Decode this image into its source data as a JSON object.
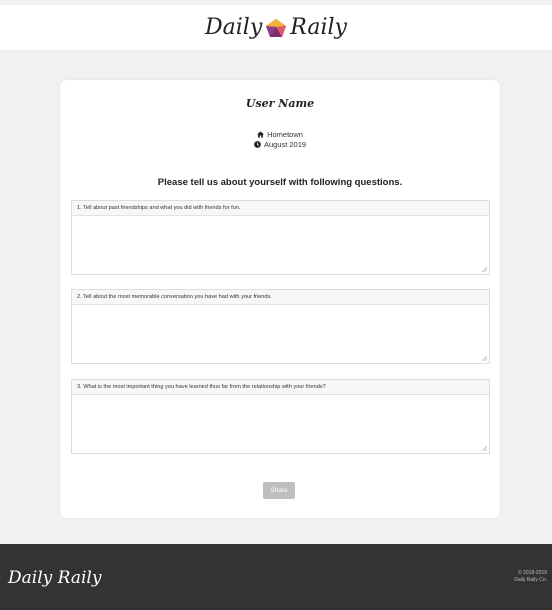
{
  "header": {
    "logo_left": "Daily",
    "logo_right": "Raily",
    "logo_icon": "pentagon-gem-icon"
  },
  "profile": {
    "name": "User Name",
    "hometown": "Hometown",
    "date": "August 2019",
    "hometown_icon": "home-icon",
    "date_icon": "clock-icon"
  },
  "form": {
    "prompt": "Please tell us about yourself with following questions.",
    "questions": [
      {
        "label": "1. Tell about past friendships and what you did with friends for fun.",
        "value": ""
      },
      {
        "label": "2. Tell about the most memorable conversation you have had with your friends.",
        "value": ""
      },
      {
        "label": "3. What is the most important thing you have learned thus far from the relationship with your friends?",
        "value": ""
      }
    ],
    "share_label": "Share"
  },
  "footer": {
    "logo": "Daily Raily",
    "copyright_line1": "© 2018-2019",
    "copyright_line2": "Daily Raily Co."
  },
  "colors": {
    "page_bg": "#f1f1f1",
    "footer_bg": "#333333",
    "button_disabled": "#bfbfbf",
    "logo_gem_top": "#f3b23a",
    "logo_gem_bottom": "#c4395a"
  }
}
